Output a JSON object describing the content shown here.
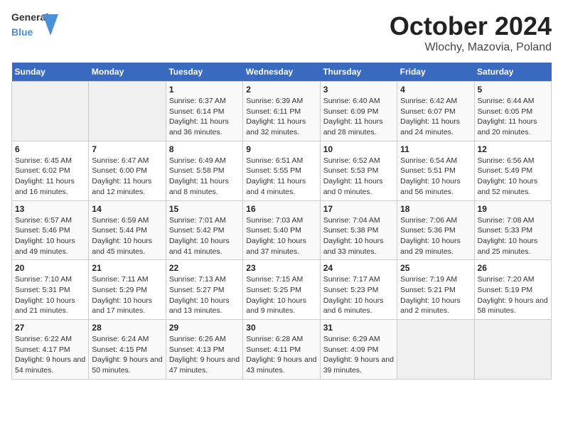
{
  "header": {
    "logo_line1": "General",
    "logo_line2": "Blue",
    "title": "October 2024",
    "subtitle": "Wlochy, Mazovia, Poland"
  },
  "weekdays": [
    "Sunday",
    "Monday",
    "Tuesday",
    "Wednesday",
    "Thursday",
    "Friday",
    "Saturday"
  ],
  "weeks": [
    [
      {
        "day": "",
        "empty": true
      },
      {
        "day": "",
        "empty": true
      },
      {
        "day": "1",
        "sunrise": "6:37 AM",
        "sunset": "6:14 PM",
        "daylight": "11 hours and 36 minutes."
      },
      {
        "day": "2",
        "sunrise": "6:39 AM",
        "sunset": "6:11 PM",
        "daylight": "11 hours and 32 minutes."
      },
      {
        "day": "3",
        "sunrise": "6:40 AM",
        "sunset": "6:09 PM",
        "daylight": "11 hours and 28 minutes."
      },
      {
        "day": "4",
        "sunrise": "6:42 AM",
        "sunset": "6:07 PM",
        "daylight": "11 hours and 24 minutes."
      },
      {
        "day": "5",
        "sunrise": "6:44 AM",
        "sunset": "6:05 PM",
        "daylight": "11 hours and 20 minutes."
      }
    ],
    [
      {
        "day": "6",
        "sunrise": "6:45 AM",
        "sunset": "6:02 PM",
        "daylight": "11 hours and 16 minutes."
      },
      {
        "day": "7",
        "sunrise": "6:47 AM",
        "sunset": "6:00 PM",
        "daylight": "11 hours and 12 minutes."
      },
      {
        "day": "8",
        "sunrise": "6:49 AM",
        "sunset": "5:58 PM",
        "daylight": "11 hours and 8 minutes."
      },
      {
        "day": "9",
        "sunrise": "6:51 AM",
        "sunset": "5:55 PM",
        "daylight": "11 hours and 4 minutes."
      },
      {
        "day": "10",
        "sunrise": "6:52 AM",
        "sunset": "5:53 PM",
        "daylight": "11 hours and 0 minutes."
      },
      {
        "day": "11",
        "sunrise": "6:54 AM",
        "sunset": "5:51 PM",
        "daylight": "10 hours and 56 minutes."
      },
      {
        "day": "12",
        "sunrise": "6:56 AM",
        "sunset": "5:49 PM",
        "daylight": "10 hours and 52 minutes."
      }
    ],
    [
      {
        "day": "13",
        "sunrise": "6:57 AM",
        "sunset": "5:46 PM",
        "daylight": "10 hours and 49 minutes."
      },
      {
        "day": "14",
        "sunrise": "6:59 AM",
        "sunset": "5:44 PM",
        "daylight": "10 hours and 45 minutes."
      },
      {
        "day": "15",
        "sunrise": "7:01 AM",
        "sunset": "5:42 PM",
        "daylight": "10 hours and 41 minutes."
      },
      {
        "day": "16",
        "sunrise": "7:03 AM",
        "sunset": "5:40 PM",
        "daylight": "10 hours and 37 minutes."
      },
      {
        "day": "17",
        "sunrise": "7:04 AM",
        "sunset": "5:38 PM",
        "daylight": "10 hours and 33 minutes."
      },
      {
        "day": "18",
        "sunrise": "7:06 AM",
        "sunset": "5:36 PM",
        "daylight": "10 hours and 29 minutes."
      },
      {
        "day": "19",
        "sunrise": "7:08 AM",
        "sunset": "5:33 PM",
        "daylight": "10 hours and 25 minutes."
      }
    ],
    [
      {
        "day": "20",
        "sunrise": "7:10 AM",
        "sunset": "5:31 PM",
        "daylight": "10 hours and 21 minutes."
      },
      {
        "day": "21",
        "sunrise": "7:11 AM",
        "sunset": "5:29 PM",
        "daylight": "10 hours and 17 minutes."
      },
      {
        "day": "22",
        "sunrise": "7:13 AM",
        "sunset": "5:27 PM",
        "daylight": "10 hours and 13 minutes."
      },
      {
        "day": "23",
        "sunrise": "7:15 AM",
        "sunset": "5:25 PM",
        "daylight": "10 hours and 9 minutes."
      },
      {
        "day": "24",
        "sunrise": "7:17 AM",
        "sunset": "5:23 PM",
        "daylight": "10 hours and 6 minutes."
      },
      {
        "day": "25",
        "sunrise": "7:19 AM",
        "sunset": "5:21 PM",
        "daylight": "10 hours and 2 minutes."
      },
      {
        "day": "26",
        "sunrise": "7:20 AM",
        "sunset": "5:19 PM",
        "daylight": "9 hours and 58 minutes."
      }
    ],
    [
      {
        "day": "27",
        "sunrise": "6:22 AM",
        "sunset": "4:17 PM",
        "daylight": "9 hours and 54 minutes."
      },
      {
        "day": "28",
        "sunrise": "6:24 AM",
        "sunset": "4:15 PM",
        "daylight": "9 hours and 50 minutes."
      },
      {
        "day": "29",
        "sunrise": "6:26 AM",
        "sunset": "4:13 PM",
        "daylight": "9 hours and 47 minutes."
      },
      {
        "day": "30",
        "sunrise": "6:28 AM",
        "sunset": "4:11 PM",
        "daylight": "9 hours and 43 minutes."
      },
      {
        "day": "31",
        "sunrise": "6:29 AM",
        "sunset": "4:09 PM",
        "daylight": "9 hours and 39 minutes."
      },
      {
        "day": "",
        "empty": true
      },
      {
        "day": "",
        "empty": true
      }
    ]
  ]
}
